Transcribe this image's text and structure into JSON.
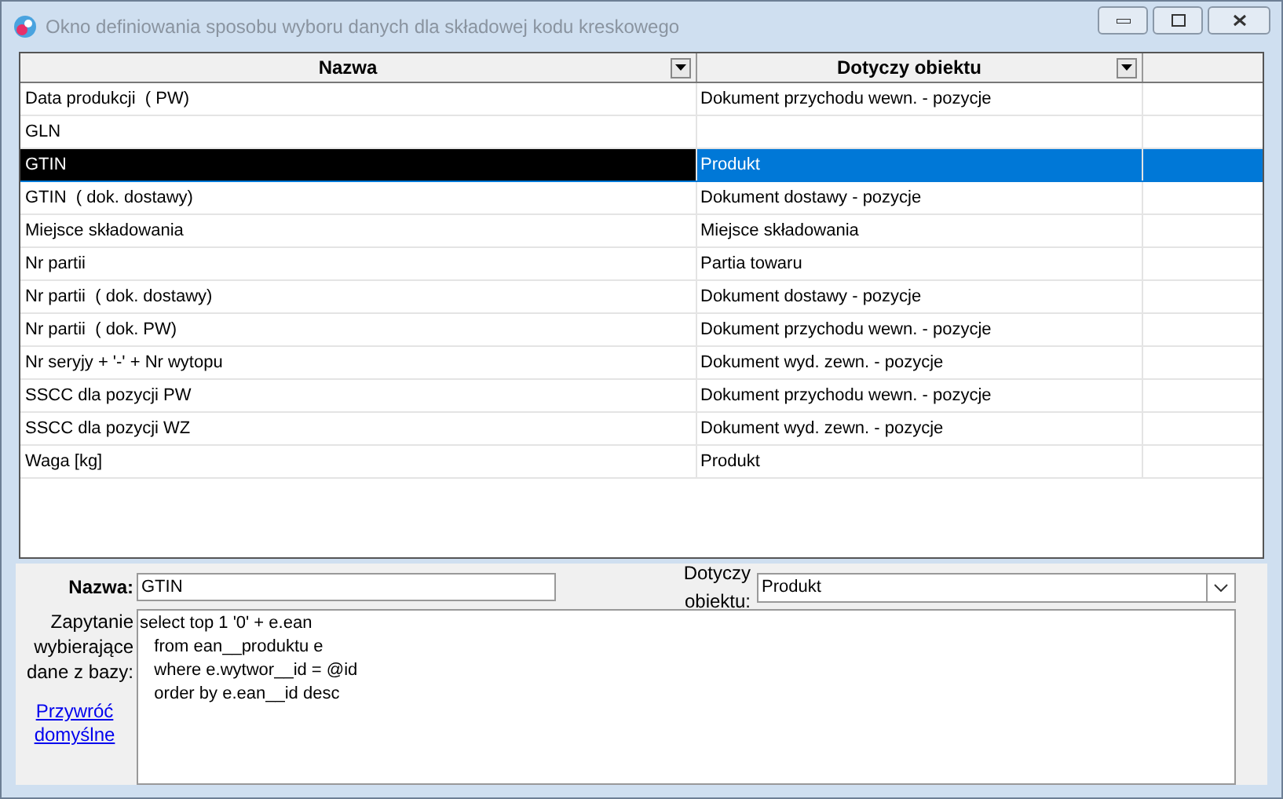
{
  "window": {
    "title": "Okno definiowania sposobu wyboru danych dla składowej kodu kreskowego"
  },
  "table": {
    "columns": [
      "Nazwa",
      "Dotyczy obiektu"
    ],
    "rows": [
      {
        "name": "Data produkcji  ( PW)",
        "object": "Dokument przychodu wewn. - pozycje",
        "selected": false
      },
      {
        "name": "GLN",
        "object": "",
        "selected": false
      },
      {
        "name": "GTIN",
        "object": "Produkt",
        "selected": true
      },
      {
        "name": "GTIN  ( dok. dostawy)",
        "object": "Dokument dostawy - pozycje",
        "selected": false
      },
      {
        "name": "Miejsce składowania",
        "object": "Miejsce składowania",
        "selected": false
      },
      {
        "name": "Nr partii",
        "object": "Partia towaru",
        "selected": false
      },
      {
        "name": "Nr partii  ( dok. dostawy)",
        "object": "Dokument dostawy - pozycje",
        "selected": false
      },
      {
        "name": "Nr partii  ( dok. PW)",
        "object": "Dokument przychodu wewn. - pozycje",
        "selected": false
      },
      {
        "name": "Nr seryjy + '-' + Nr wytopu",
        "object": "Dokument wyd. zewn. - pozycje",
        "selected": false
      },
      {
        "name": "SSCC dla pozycji PW",
        "object": "Dokument przychodu wewn. - pozycje",
        "selected": false
      },
      {
        "name": "SSCC dla pozycji WZ",
        "object": "Dokument wyd. zewn. - pozycje",
        "selected": false
      },
      {
        "name": "Waga [kg]",
        "object": "Produkt",
        "selected": false
      }
    ]
  },
  "form": {
    "name_label": "Nazwa:",
    "name_value": "GTIN",
    "object_label": "Dotyczy obiektu:",
    "object_value": "Produkt",
    "query_label": "Zapytanie wybierające dane z bazy:",
    "query": "select top 1 '0' + e.ean\n   from ean__produktu e\n   where e.wytwor__id = @id\n   order by e.ean__id desc",
    "restore_link": "Przywróć domyślne"
  }
}
